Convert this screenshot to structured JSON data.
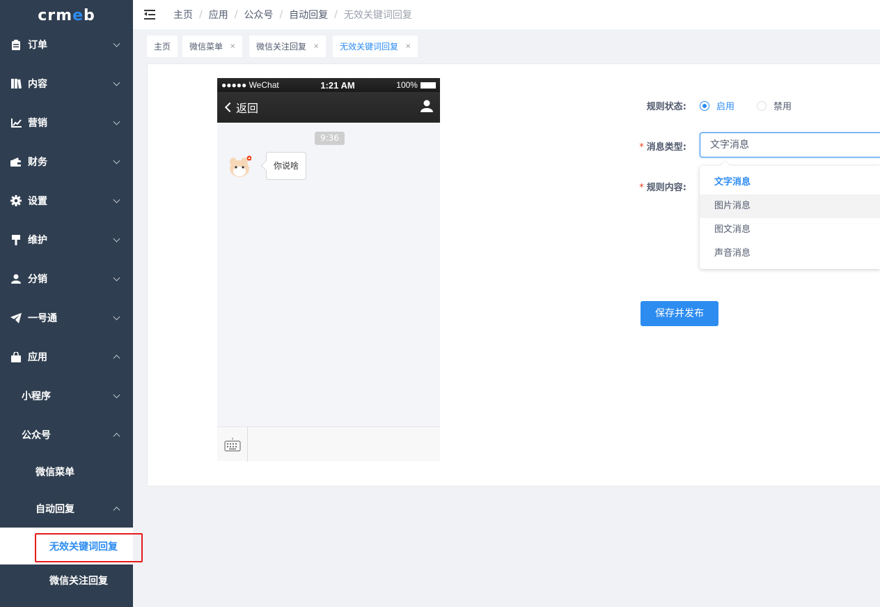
{
  "logo": {
    "pre": "crm",
    "mid": "e",
    "post": "b"
  },
  "sidebar": {
    "items": [
      {
        "label": "订单",
        "icon": "clipboard-icon"
      },
      {
        "label": "内容",
        "icon": "book-icon"
      },
      {
        "label": "营销",
        "icon": "chart-line-icon"
      },
      {
        "label": "财务",
        "icon": "wallet-icon"
      },
      {
        "label": "设置",
        "icon": "gear-icon"
      },
      {
        "label": "维护",
        "icon": "brush-icon"
      },
      {
        "label": "分销",
        "icon": "user-icon"
      },
      {
        "label": "一号通",
        "icon": "paper-plane-icon"
      },
      {
        "label": "应用",
        "icon": "shopping-bag-icon"
      }
    ],
    "sub": {
      "mini_program": "小程序",
      "official_account": "公众号",
      "wechat_menu": "微信菜单",
      "auto_reply": "自动回复",
      "invalid_keyword_reply": "无效关键词回复",
      "follow_reply": "微信关注回复"
    }
  },
  "breadcrumb": [
    "主页",
    "应用",
    "公众号",
    "自动回复",
    "无效关键词回复"
  ],
  "breadcrumb_sep": "/",
  "tabs": [
    {
      "label": "主页"
    },
    {
      "label": "微信菜单",
      "close": "×"
    },
    {
      "label": "微信关注回复",
      "close": "×"
    },
    {
      "label": "无效关键词回复",
      "close": "×"
    }
  ],
  "phone": {
    "carrier": "●●●●● WeChat",
    "time": "1:21 AM",
    "battery": "100%",
    "back_label": "返回",
    "chat_time": "9:36",
    "message": "你说啥"
  },
  "form": {
    "status_label": "规则状态:",
    "status_on": "启用",
    "status_off": "禁用",
    "type_label": "消息类型:",
    "type_value": "文字消息",
    "content_label": "规则内容:",
    "required_mark": "*",
    "options": [
      "文字消息",
      "图片消息",
      "图文消息",
      "声音消息"
    ],
    "submit_label": "保存并发布"
  },
  "colors": {
    "primary": "#2d8cf0",
    "sidebar_bg": "#2f3e50",
    "highlight": "#e81a1a"
  }
}
